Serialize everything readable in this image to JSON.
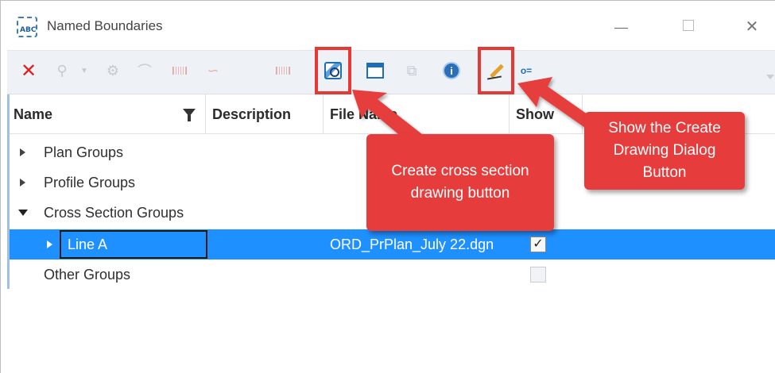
{
  "window": {
    "title": "Named Boundaries",
    "app_icon_text": "ABC",
    "close_glyph": "✕"
  },
  "toolbar": {
    "items": [
      {
        "name": "delete",
        "icon": "red-x-icon"
      },
      {
        "name": "place",
        "icon": "pin-icon",
        "enabled": false
      },
      {
        "name": "dropdown",
        "icon": "chevron-down-icon",
        "enabled": false
      },
      {
        "name": "civil",
        "icon": "civil-icon",
        "enabled": false
      },
      {
        "name": "profile",
        "icon": "profile-icon",
        "enabled": false
      },
      {
        "name": "grid1",
        "icon": "grid-icon",
        "enabled": false
      },
      {
        "name": "curve",
        "icon": "curve-icon",
        "enabled": false
      },
      {
        "name": "grid2",
        "icon": "grid-icon",
        "enabled": false
      },
      {
        "name": "cross-section",
        "icon": "cross-section-icon",
        "enabled": true
      },
      {
        "name": "frame",
        "icon": "frame-icon",
        "enabled": true
      },
      {
        "name": "connect",
        "icon": "connect-icon",
        "enabled": false
      },
      {
        "name": "info",
        "icon": "info-icon",
        "enabled": true
      },
      {
        "name": "create-drawing",
        "icon": "pencil-icon",
        "enabled": true
      },
      {
        "name": "key",
        "icon": "key-icon",
        "enabled": true
      }
    ],
    "key_text": "o=",
    "info_text": "i"
  },
  "columns": {
    "name": "Name",
    "description": "Description",
    "file": "File Name",
    "show": "Show"
  },
  "rows": [
    {
      "label": "Plan Groups",
      "expander": "closed",
      "file": "",
      "show": null
    },
    {
      "label": "Profile Groups",
      "expander": "closed",
      "file": "",
      "show": null
    },
    {
      "label": "Cross Section Groups",
      "expander": "open",
      "file": "",
      "show": null
    },
    {
      "label": "Line A",
      "expander": "closed",
      "file": "ORD_PrPlan_July 22.dgn",
      "show": true,
      "selected": true
    },
    {
      "label": "Other Groups",
      "expander": "none",
      "file": "",
      "show": false
    }
  ],
  "callouts": {
    "cross_section": "Create cross section drawing button",
    "create_drawing": "Show the Create Drawing Dialog Button"
  },
  "colors": {
    "highlight": "#e53935",
    "callout": "#e63c3c",
    "selection": "#1e90ff"
  }
}
